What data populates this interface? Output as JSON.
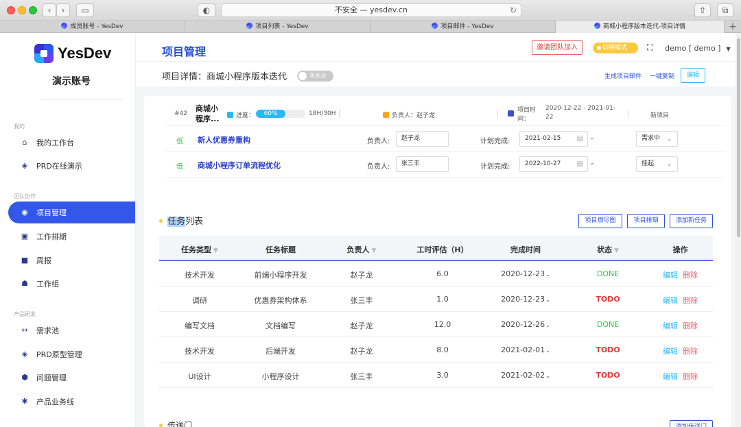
{
  "browser": {
    "address_text": "不安全 — yesdev.cn",
    "tabs": [
      {
        "label": "成员账号 - YesDev"
      },
      {
        "label": "项目列表 - YesDev"
      },
      {
        "label": "项目邮件 - YesDev"
      },
      {
        "label": "商城小程序版本迭代-项目详情"
      }
    ]
  },
  "sidebar": {
    "logo_text": "YesDev",
    "account_name": "演示账号",
    "groups": [
      {
        "label": "我的"
      },
      {
        "label": "团队协作"
      },
      {
        "label": "产品研发"
      }
    ],
    "items": [
      {
        "label": "我的工作台",
        "icon": "home-icon"
      },
      {
        "label": "PRD在线演示",
        "icon": "layers-icon"
      },
      {
        "label": "项目管理",
        "icon": "compass-icon"
      },
      {
        "label": "工作排期",
        "icon": "calendar-icon"
      },
      {
        "label": "周报",
        "icon": "report-icon"
      },
      {
        "label": "工作组",
        "icon": "team-icon"
      },
      {
        "label": "需求池",
        "icon": "arrows-icon"
      },
      {
        "label": "PRD原型管理",
        "icon": "layers-icon"
      },
      {
        "label": "问题管理",
        "icon": "cube-icon"
      },
      {
        "label": "产品业务线",
        "icon": "gear-icon"
      }
    ]
  },
  "header": {
    "title": "项目管理",
    "invite_label": "邀请团队加入",
    "switch_label": "切换模式",
    "user_label": "demo [ demo ]"
  },
  "subheader": {
    "detail_title": "项目详情：商城小程序版本迭代",
    "follow_label": "未关注",
    "gen_email_label": "生成项目邮件",
    "copy_label": "一键复制",
    "edit_label": "编辑"
  },
  "project": {
    "id": "#42",
    "name": "商城小程序...",
    "progress_label": "进度：",
    "progress_percent": 60,
    "progress_text": "60%",
    "hours": "18H/30H",
    "owner": "负责人：赵子龙",
    "time_label": "项目时间：",
    "time_value": "2020-12-22 - 2021-01-22",
    "status": "新项目"
  },
  "requirements": [
    {
      "priority": "低",
      "title": "新人优惠券重构",
      "owner_label": "负责人:",
      "owner": "赵子龙",
      "plan_label": "计划完成:",
      "date": "2021-02-15",
      "status": "需求中"
    },
    {
      "priority": "低",
      "title": "商城小程序订单流程优化",
      "owner_label": "负责人:",
      "owner": "张三丰",
      "plan_label": "计划完成:",
      "date": "2022-10-27",
      "status": "挂起"
    }
  ],
  "tasks": {
    "title_highlight": "任务",
    "title_rest": "列表",
    "buttons": {
      "burndown": "项目燃尽图",
      "schedule": "项目排期",
      "add": "添加新任务"
    },
    "columns": [
      "任务类型",
      "任务标题",
      "负责人",
      "工时评估（H）",
      "完成时间",
      "状态",
      "操作"
    ],
    "edit_label": "编辑",
    "delete_label": "删除",
    "rows": [
      {
        "type": "技术开发",
        "title": "前端小程序开发",
        "owner": "赵子龙",
        "hours": "6.0",
        "date": "2020-12-23",
        "status": "DONE"
      },
      {
        "type": "调研",
        "title": "优惠券架构体系",
        "owner": "张三丰",
        "hours": "1.0",
        "date": "2020-12-23",
        "status": "TODO"
      },
      {
        "type": "编写文档",
        "title": "文档编写",
        "owner": "赵子龙",
        "hours": "12.0",
        "date": "2020-12-26",
        "status": "DONE"
      },
      {
        "type": "技术开发",
        "title": "后端开发",
        "owner": "赵子龙",
        "hours": "8.0",
        "date": "2021-02-01",
        "status": "TODO"
      },
      {
        "type": "UI设计",
        "title": "小程序设计",
        "owner": "张三丰",
        "hours": "3.0",
        "date": "2021-02-02",
        "status": "TODO"
      }
    ]
  },
  "section2": {
    "title": "传送门",
    "button": "添加传送门"
  }
}
